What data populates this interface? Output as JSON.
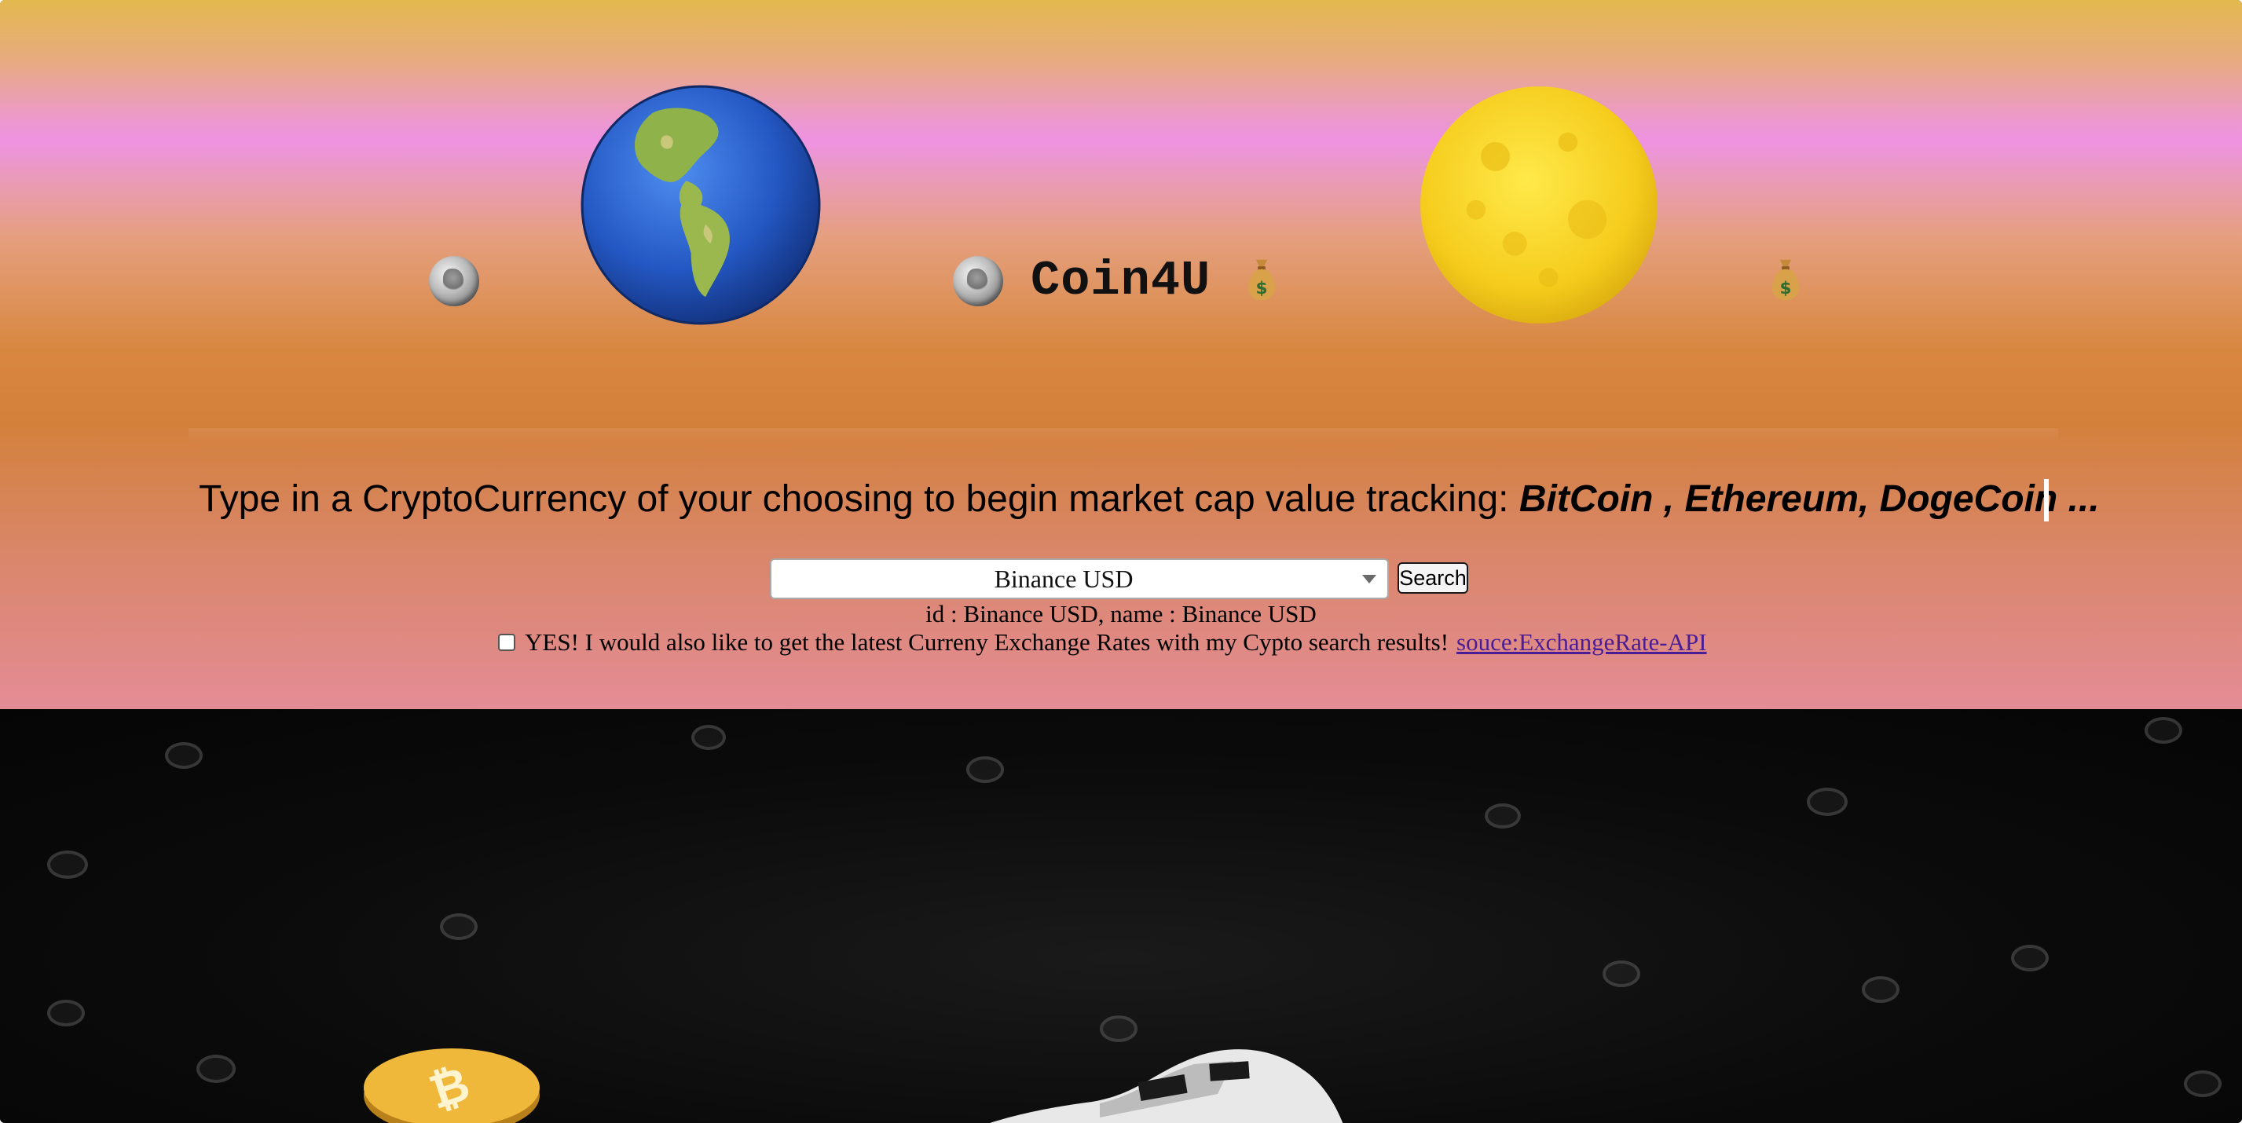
{
  "app": {
    "brand": "Coin4U"
  },
  "header": {
    "icons": [
      "coin-icon",
      "globe-americas-icon",
      "coin-icon",
      "money-bag-icon",
      "full-moon-icon",
      "money-bag-icon"
    ]
  },
  "search": {
    "prompt_text": "Type in a CryptoCurrency of your choosing to begin market cap value tracking: ",
    "prompt_examples": "BitCoin , Ethereum, DogeCoin ...",
    "selected_currency": "Binance USD",
    "search_button_label": "Search",
    "result_text": "id : Binance USD, name : Binance USD",
    "optin_label": "YES! I would also like to get the latest Curreny Exchange Rates with my Cypto search results!",
    "optin_checked": false,
    "source_link_text": "souce:ExchangeRate-API"
  },
  "colors": {
    "header_top": "#e3b94e",
    "header_mid": "#ee92e2",
    "header_bottom": "#d3803a",
    "panel_bottom": "#e48c96",
    "link": "#4a1d96",
    "hero_bg": "#0b0b0b"
  }
}
